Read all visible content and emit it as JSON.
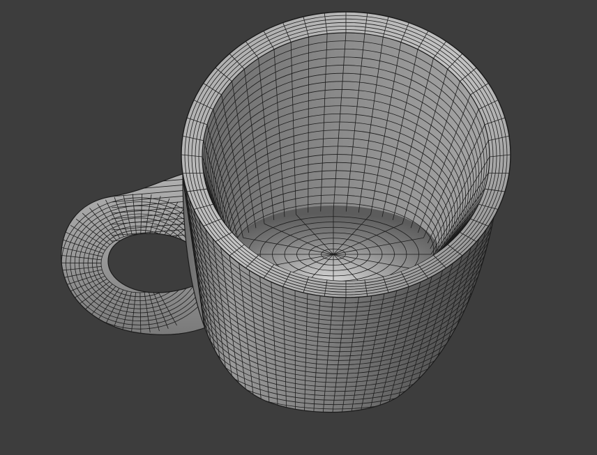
{
  "viewport": {
    "background_color": "#3d3d3d",
    "mesh_base_color": "#8a8a8a",
    "mesh_highlight_color": "#c8c8c8",
    "mesh_shadow_color": "#4e4e4e",
    "wire_color": "#1b1b1b"
  },
  "object": {
    "kind": "mug",
    "display_mode": "solid-with-wireframe-overlay",
    "parts": [
      "cup-body",
      "cup-rim",
      "cup-interior",
      "cup-handle"
    ]
  }
}
